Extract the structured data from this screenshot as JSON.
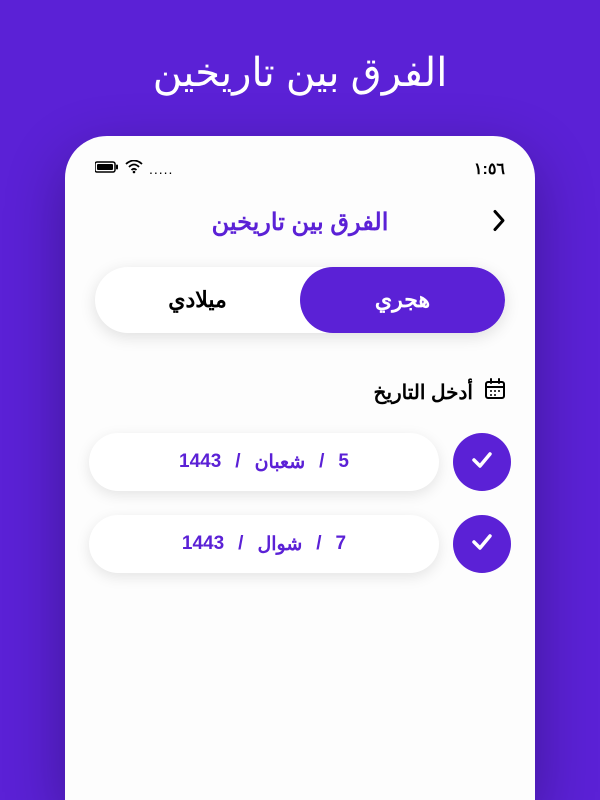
{
  "page": {
    "title": "الفرق بين تاريخين"
  },
  "statusBar": {
    "dots": ".....",
    "time": "١:٥٦"
  },
  "header": {
    "title": "الفرق بين تاريخين"
  },
  "tabs": {
    "hijri": "هجري",
    "gregorian": "ميلادي"
  },
  "section": {
    "enterDate": "أدخل التاريخ"
  },
  "dates": [
    {
      "day": "5",
      "month": "شعبان",
      "year": "1443"
    },
    {
      "day": "7",
      "month": "شوال",
      "year": "1443"
    }
  ],
  "separator": "/"
}
